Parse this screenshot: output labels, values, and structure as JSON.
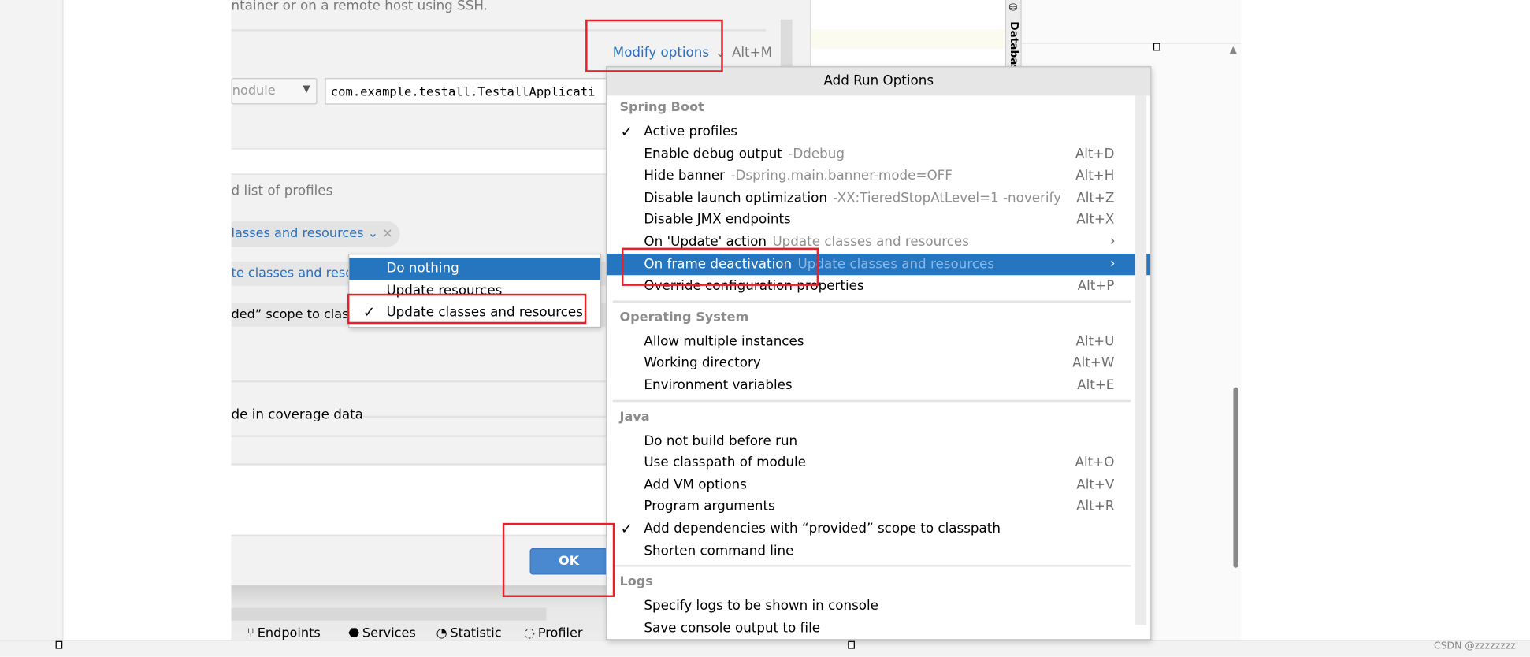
{
  "dialog": {
    "description_fragment": "ntainer or on a remote host using SSH.",
    "modify_options": "Modify options",
    "modify_shortcut": "Alt+M",
    "module_combo": "nodule",
    "main_class": "com.example.testall.TestallApplicati",
    "profiles_hint": "d list of profiles",
    "update_action_chip": "lasses and resources",
    "frame_deactivation_value": "te classes and reso",
    "provided_scope_fragment": "ded” scope to clas",
    "coverage_fragment": "de in coverage data",
    "ok_label": "OK"
  },
  "toolbar": {
    "tabs": [
      {
        "label": "Endpoints",
        "icon": "endpoints-icon"
      },
      {
        "label": "Services",
        "icon": "services-icon"
      },
      {
        "label": "Statistic",
        "icon": "statistic-icon"
      },
      {
        "label": "Profiler",
        "icon": "profiler-icon"
      }
    ]
  },
  "side_tab": {
    "label": "Database"
  },
  "popup": {
    "title": "Add Run Options",
    "sections": {
      "spring_boot": "Spring Boot",
      "operating_system": "Operating System",
      "java": "Java",
      "logs": "Logs"
    },
    "spring_items": [
      {
        "label": "Active profiles",
        "checked": true,
        "hint": "",
        "shortcut": ""
      },
      {
        "label": "Enable debug output",
        "hint": "-Ddebug",
        "shortcut": "Alt+D"
      },
      {
        "label": "Hide banner",
        "hint": "-Dspring.main.banner-mode=OFF",
        "shortcut": "Alt+H"
      },
      {
        "label": "Disable launch optimization",
        "hint": "-XX:TieredStopAtLevel=1 -noverify",
        "shortcut": "Alt+Z"
      },
      {
        "label": "Disable JMX endpoints",
        "hint": "",
        "shortcut": "Alt+X"
      },
      {
        "label": "On 'Update' action",
        "hint": "Update classes and resources",
        "submenu": true
      },
      {
        "label": "On frame deactivation",
        "hint": "Update classes and resources",
        "submenu": true,
        "selected": true
      },
      {
        "label": "Override configuration properties",
        "hint": "",
        "shortcut": "Alt+P"
      }
    ],
    "os_items": [
      {
        "label": "Allow multiple instances",
        "shortcut": "Alt+U"
      },
      {
        "label": "Working directory",
        "shortcut": "Alt+W"
      },
      {
        "label": "Environment variables",
        "shortcut": "Alt+E"
      }
    ],
    "java_items": [
      {
        "label": "Do not build before run",
        "shortcut": ""
      },
      {
        "label": "Use classpath of module",
        "shortcut": "Alt+O"
      },
      {
        "label": "Add VM options",
        "shortcut": "Alt+V"
      },
      {
        "label": "Program arguments",
        "shortcut": "Alt+R"
      },
      {
        "label": "Add dependencies with “provided” scope to classpath",
        "checked": true,
        "shortcut": ""
      },
      {
        "label": "Shorten command line",
        "shortcut": ""
      }
    ],
    "logs_items": [
      {
        "label": "Specify logs to be shown in console"
      },
      {
        "label": "Save console output to file"
      }
    ]
  },
  "submenu": {
    "items": [
      {
        "label": "Do nothing",
        "selected": true
      },
      {
        "label": "Update resources"
      },
      {
        "label": "Update classes and resources",
        "checked": true
      }
    ]
  },
  "watermark": "CSDN @zzzzzzzz'",
  "colors": {
    "accent": "#2675bf",
    "ok_button": "#4a88d0",
    "annotation_red": "#e8202a",
    "link": "#2a6fc0"
  }
}
